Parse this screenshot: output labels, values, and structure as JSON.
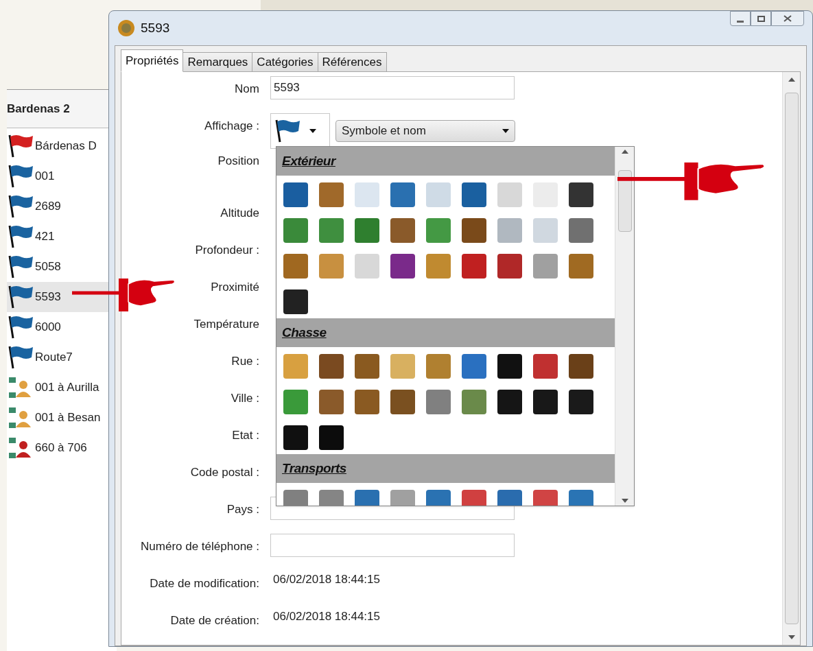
{
  "list_panel": {
    "title": "Bardenas 2",
    "items": [
      {
        "label": "Bárdenas D",
        "kind": "flag",
        "color": "#d42020",
        "selected": false
      },
      {
        "label": "001",
        "kind": "flag",
        "color": "#1a63a0",
        "selected": false
      },
      {
        "label": "2689",
        "kind": "flag",
        "color": "#1a63a0",
        "selected": false
      },
      {
        "label": "421",
        "kind": "flag",
        "color": "#1a63a0",
        "selected": false
      },
      {
        "label": "5058",
        "kind": "flag",
        "color": "#1a63a0",
        "selected": false
      },
      {
        "label": "5593",
        "kind": "flag",
        "color": "#1a63a0",
        "selected": true
      },
      {
        "label": "6000",
        "kind": "flag",
        "color": "#1a63a0",
        "selected": false
      },
      {
        "label": "Route7",
        "kind": "flag",
        "color": "#1a63a0",
        "selected": false
      },
      {
        "label": "001 à Aurilla",
        "kind": "route",
        "color": "#e0a040",
        "selected": false
      },
      {
        "label": "001 à Besan",
        "kind": "route",
        "color": "#e0a040",
        "selected": false
      },
      {
        "label": "660 à 706",
        "kind": "route",
        "color": "#c02020",
        "selected": false
      }
    ]
  },
  "window": {
    "title": "5593",
    "tabs": [
      {
        "label": "Propriétés",
        "selected": true
      },
      {
        "label": "Remarques",
        "selected": false
      },
      {
        "label": "Catégories",
        "selected": false
      },
      {
        "label": "Références",
        "selected": false
      }
    ],
    "fields": [
      {
        "label": "Nom",
        "kind": "text",
        "value": "5593"
      },
      {
        "label": "Affichage :",
        "kind": "symbol",
        "value": "Symbole et nom"
      },
      {
        "label": "Position",
        "kind": "covered_tall"
      },
      {
        "label": "Altitude",
        "kind": "covered"
      },
      {
        "label": "Profondeur :",
        "kind": "covered"
      },
      {
        "label": "Proximité",
        "kind": "covered"
      },
      {
        "label": "Température",
        "kind": "covered"
      },
      {
        "label": "Rue :",
        "kind": "covered"
      },
      {
        "label": "Ville :",
        "kind": "covered"
      },
      {
        "label": "Etat :",
        "kind": "covered"
      },
      {
        "label": "Code postal :",
        "kind": "covered"
      },
      {
        "label": "Pays :",
        "kind": "text"
      },
      {
        "label": "Numéro de téléphone :",
        "kind": "text"
      },
      {
        "label": "Date de modification:",
        "kind": "date",
        "value": "06/02/2018 18:44:15"
      },
      {
        "label": "Date de création:",
        "kind": "date",
        "value": "06/02/2018 18:44:15"
      }
    ],
    "symbol_picker": {
      "groups": [
        {
          "title": "Extérieur",
          "symbols": [
            {
              "color": "#1a5ea0"
            },
            {
              "color": "#a0692a"
            },
            {
              "color": "#dce6f0"
            },
            {
              "color": "#2a70b0"
            },
            {
              "color": "#cfdbe6"
            },
            {
              "color": "#1a60a0"
            },
            {
              "color": "#d8d8d8"
            },
            {
              "color": "#ececec"
            },
            {
              "color": "#333333"
            },
            {
              "color": "#3a8a3a"
            },
            {
              "color": "#3f8f3f"
            },
            {
              "color": "#2f7f2f"
            },
            {
              "color": "#8a5a2a"
            },
            {
              "color": "#449944"
            },
            {
              "color": "#7a4a1a"
            },
            {
              "color": "#b0b8c0"
            },
            {
              "color": "#d0d8e0"
            },
            {
              "color": "#707070"
            },
            {
              "color": "#a06820"
            },
            {
              "color": "#c89040"
            },
            {
              "color": "#d8d8d8"
            },
            {
              "color": "#7a2a8a"
            },
            {
              "color": "#c08a30"
            },
            {
              "color": "#c02020"
            },
            {
              "color": "#b02828"
            },
            {
              "color": "#a0a0a0"
            },
            {
              "color": "#a06a22"
            },
            {
              "color": "#222222"
            }
          ]
        },
        {
          "title": "Chasse",
          "symbols": [
            {
              "color": "#d8a040"
            },
            {
              "color": "#7a4a20"
            },
            {
              "color": "#8a5a20"
            },
            {
              "color": "#d8b060"
            },
            {
              "color": "#b08030"
            },
            {
              "color": "#2a70c0"
            },
            {
              "color": "#111111"
            },
            {
              "color": "#c03030"
            },
            {
              "color": "#6a4018"
            },
            {
              "color": "#3a9a3a"
            },
            {
              "color": "#8a5a2a"
            },
            {
              "color": "#8a5a22"
            },
            {
              "color": "#7a5020"
            },
            {
              "color": "#808080"
            },
            {
              "color": "#6a8a4a"
            },
            {
              "color": "#151515"
            },
            {
              "color": "#181818"
            },
            {
              "color": "#1a1a1a"
            },
            {
              "color": "#101010"
            },
            {
              "color": "#0c0c0c"
            }
          ]
        },
        {
          "title": "Transports",
          "symbols": [
            {
              "color": "#808080"
            },
            {
              "color": "#858585"
            },
            {
              "color": "#2a70b0"
            },
            {
              "color": "#a0a0a0"
            },
            {
              "color": "#2a72b2"
            },
            {
              "color": "#d04040"
            },
            {
              "color": "#2a6cae"
            },
            {
              "color": "#d04444"
            },
            {
              "color": "#2a74b4"
            }
          ]
        }
      ]
    }
  }
}
